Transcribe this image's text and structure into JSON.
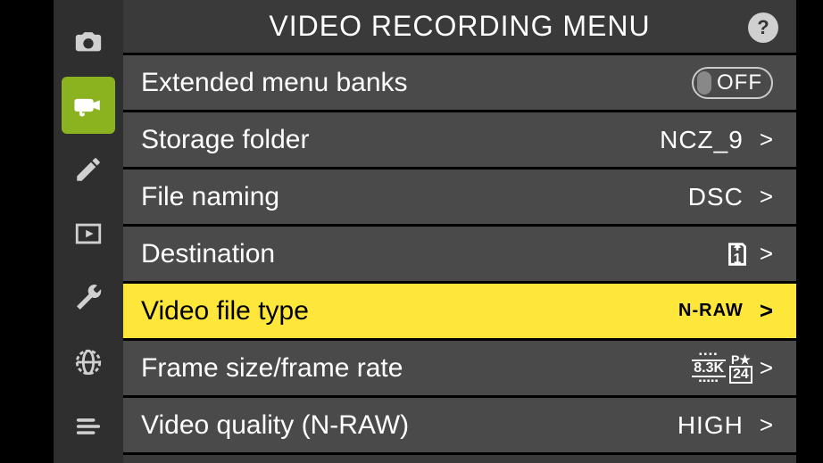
{
  "header": {
    "title": "VIDEO RECORDING MENU",
    "help": "?"
  },
  "sidebar": {
    "items": [
      {
        "name": "photo",
        "active": false
      },
      {
        "name": "video",
        "active": true
      },
      {
        "name": "pencil",
        "active": false
      },
      {
        "name": "playback",
        "active": false
      },
      {
        "name": "wrench",
        "active": false
      },
      {
        "name": "network",
        "active": false
      },
      {
        "name": "mymenu",
        "active": false
      }
    ]
  },
  "menu": {
    "items": [
      {
        "label": "Extended menu banks",
        "value": "OFF",
        "value_type": "toggle",
        "chevron": false,
        "highlighted": false
      },
      {
        "label": "Storage folder",
        "value": "NCZ_9",
        "value_type": "text",
        "chevron": true,
        "highlighted": false
      },
      {
        "label": "File naming",
        "value": "DSC",
        "value_type": "text",
        "chevron": true,
        "highlighted": false
      },
      {
        "label": "Destination",
        "value": "1",
        "value_type": "card_slot",
        "chevron": true,
        "highlighted": false
      },
      {
        "label": "Video file type",
        "value": "N-RAW",
        "value_type": "text",
        "chevron": true,
        "highlighted": true
      },
      {
        "label": "Frame size/frame rate",
        "value": "8.3K",
        "value_extra": "24",
        "value_star": "P★",
        "value_type": "framesize",
        "chevron": true,
        "highlighted": false
      },
      {
        "label": "Video quality (N-RAW)",
        "value": "HIGH",
        "value_type": "text",
        "chevron": true,
        "highlighted": false
      }
    ]
  },
  "colors": {
    "highlight": "#ffe63b",
    "active_tab": "#8bb31f",
    "bg": "#3a3a3a",
    "row": "#4a4a4a"
  }
}
